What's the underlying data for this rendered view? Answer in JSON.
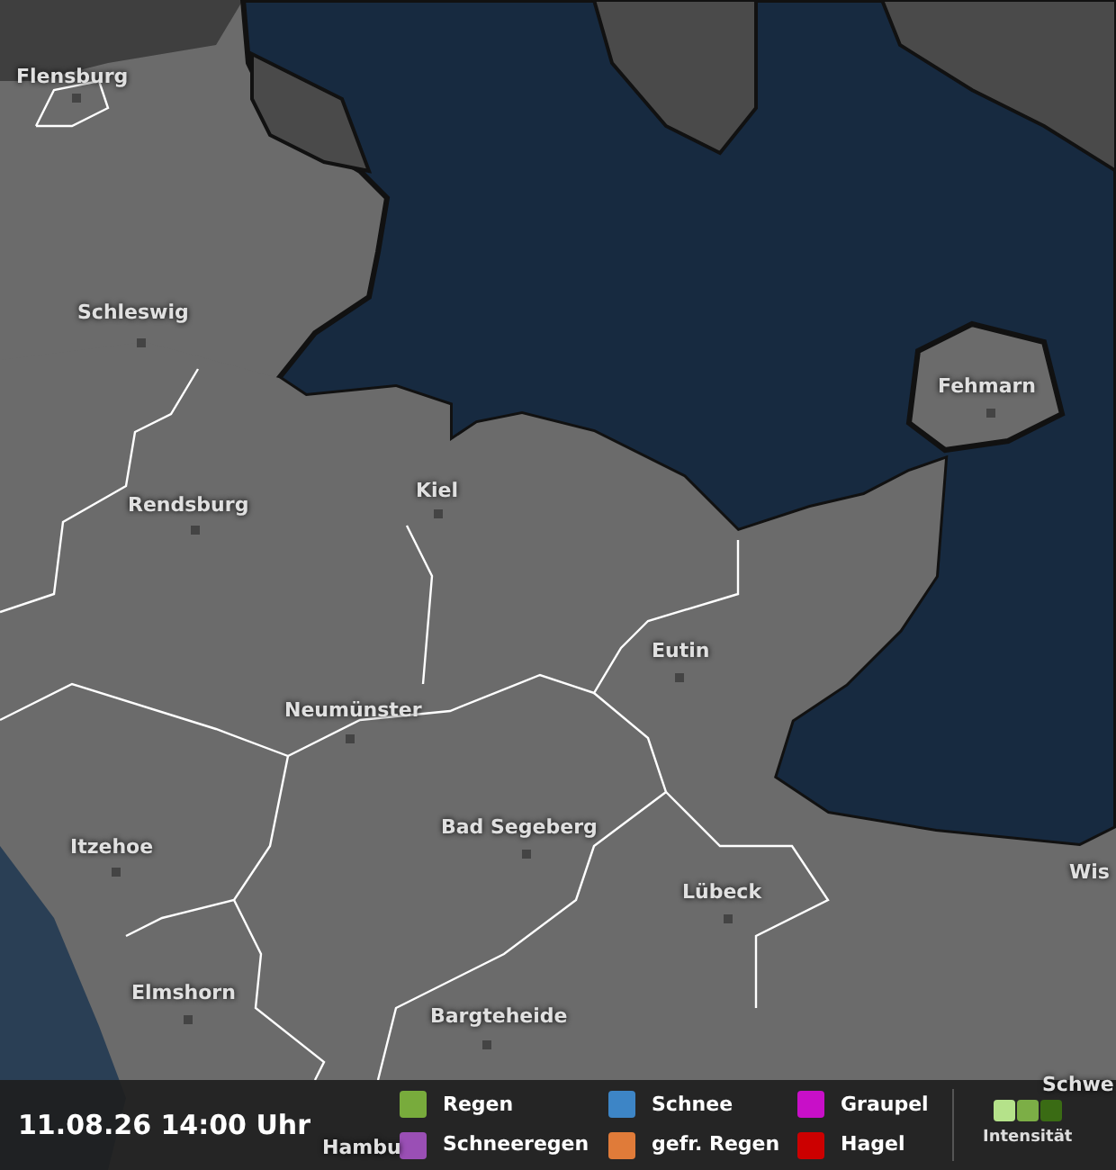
{
  "map": {
    "cities": [
      {
        "name": "Flensburg"
      },
      {
        "name": "Schleswig"
      },
      {
        "name": "Fehmarn"
      },
      {
        "name": "Kiel"
      },
      {
        "name": "Rendsburg"
      },
      {
        "name": "Eutin"
      },
      {
        "name": "Neumünster"
      },
      {
        "name": "Itzehoe"
      },
      {
        "name": "Bad Segeberg"
      },
      {
        "name": "Lübeck"
      },
      {
        "name": "Wis"
      },
      {
        "name": "Elmshorn"
      },
      {
        "name": "Bargteheide"
      },
      {
        "name": "Hambu"
      },
      {
        "name": "Schwe"
      }
    ]
  },
  "timestamp": "11.08.26 14:00 Uhr",
  "legend": {
    "items": [
      {
        "label": "Regen",
        "color": "#78ab3c"
      },
      {
        "label": "Schnee",
        "color": "#3d85c6"
      },
      {
        "label": "Graupel",
        "color": "#c80fc8"
      },
      {
        "label": "Schneeregen",
        "color": "#9a4fb5"
      },
      {
        "label": "gefr. Regen",
        "color": "#e07b39"
      },
      {
        "label": "Hagel",
        "color": "#cc0000"
      }
    ],
    "intensity": {
      "label": "Intensität",
      "levels": [
        {
          "color": "#b5e28a"
        },
        {
          "color": "#7cae46"
        },
        {
          "color": "#3a6b14"
        }
      ]
    }
  }
}
